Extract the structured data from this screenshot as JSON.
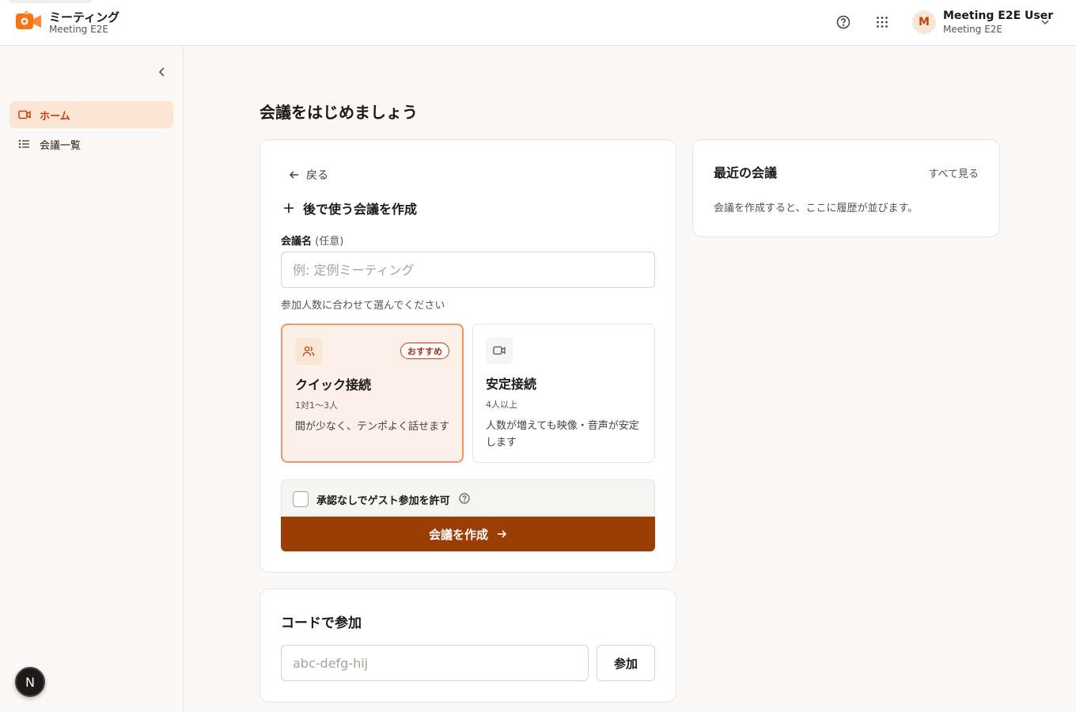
{
  "header": {
    "app_name": "ミーティング",
    "app_sub": "Meeting E2E",
    "user": {
      "initial": "M",
      "name": "Meeting E2E User",
      "sub": "Meeting E2E"
    }
  },
  "sidebar": {
    "items": [
      {
        "label": "ホーム",
        "icon": "video-icon",
        "active": true
      },
      {
        "label": "会議一覧",
        "icon": "list-icon",
        "active": false
      }
    ],
    "badge_letter": "N"
  },
  "main": {
    "title": "会議をはじめましょう",
    "create": {
      "back_label": "戻る",
      "heading": "後で使う会議を作成",
      "name_label": "会議名",
      "name_optional": "(任意)",
      "name_placeholder": "例: 定例ミーティング",
      "hint": "参加人数に合わせて選んでください",
      "options": [
        {
          "title": "クイック接続",
          "size": "1対1〜3人",
          "desc": "間が少なく、テンポよく話せます",
          "badge": "おすすめ",
          "icon": "users-icon",
          "selected": true
        },
        {
          "title": "安定接続",
          "size": "4人以上",
          "desc": "人数が増えても映像・音声が安定します",
          "icon": "video-icon",
          "selected": false
        }
      ],
      "guest_label": "承認なしでゲスト参加を許可",
      "guest_checked": false,
      "submit_label": "会議を作成"
    },
    "join": {
      "title": "コードで参加",
      "placeholder": "abc-defg-hij",
      "button_label": "参加"
    },
    "recent": {
      "title": "最近の会議",
      "see_all": "すべて見る",
      "empty": "会議を作成すると、ここに履歴が並びます。"
    }
  },
  "colors": {
    "accent": "#c2410c",
    "primary_button": "#9a3e06",
    "selected_bg": "#fdf0e8",
    "selected_border": "#ea9966"
  }
}
